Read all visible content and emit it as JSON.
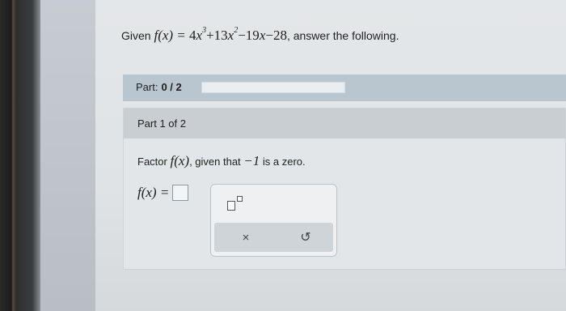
{
  "question": {
    "prefix": "Given",
    "function_lhs": "f(x) = ",
    "suffix": ", answer the following."
  },
  "progress": {
    "label": "Part:",
    "value": "0 / 2",
    "fraction": 0
  },
  "part": {
    "header": "Part 1 of 2",
    "instruction_prefix": "Factor",
    "instruction_func": "f(x)",
    "instruction_mid": ", given that",
    "instruction_value": "−1",
    "instruction_suffix": "is a zero.",
    "answer_label": "f(x) ="
  },
  "toolbox": {
    "clear_symbol": "×",
    "undo_symbol": "↺"
  }
}
